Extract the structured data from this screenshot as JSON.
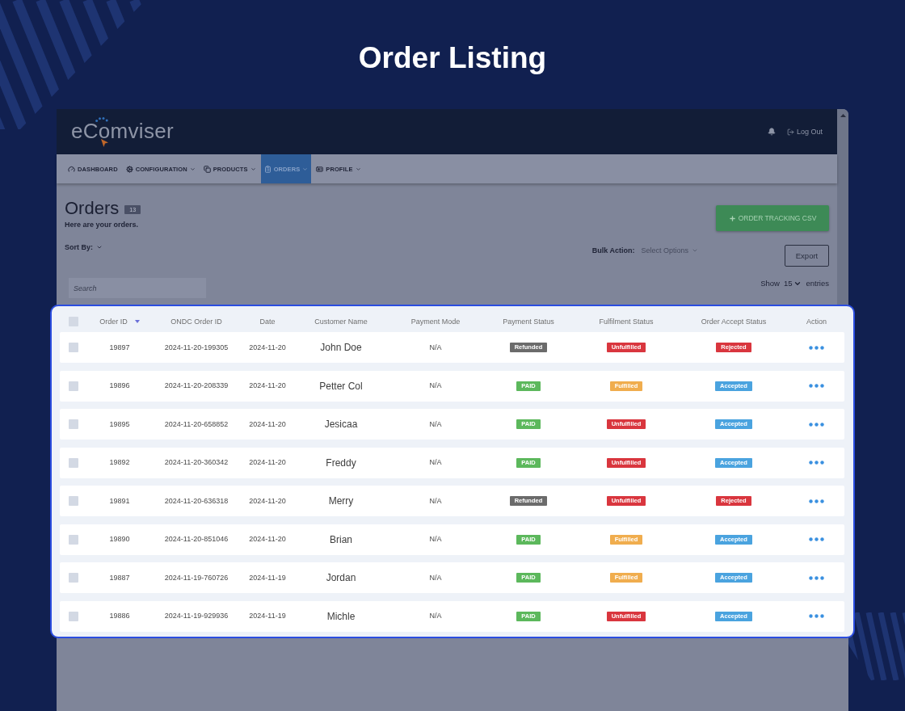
{
  "page": {
    "title": "Order Listing"
  },
  "app": {
    "logo": "eComviser",
    "logout": "Log Out",
    "nav": [
      {
        "label": "DASHBOARD",
        "dropdown": false,
        "selected": false
      },
      {
        "label": "CONFIGURATION",
        "dropdown": true,
        "selected": false
      },
      {
        "label": "PRODUCTS",
        "dropdown": true,
        "selected": false
      },
      {
        "label": "ORDERS",
        "dropdown": true,
        "selected": true
      },
      {
        "label": "PROFILE",
        "dropdown": true,
        "selected": false
      }
    ]
  },
  "orders": {
    "title": "Orders",
    "count": "13",
    "subtitle": "Here are your orders.",
    "sort_by": "Sort By:",
    "csv_button": "ORDER TRACKING CSV",
    "bulk_action": {
      "label": "Bulk Action:",
      "placeholder": "Select Options"
    },
    "export_button": "Export",
    "search": {
      "placeholder": "Search"
    },
    "show_entries": {
      "label": "Show",
      "value": "15",
      "suffix": "entries"
    }
  },
  "table": {
    "select_all": {
      "checked": false
    },
    "columns": [
      {
        "label": "Order ID",
        "sorted": true
      },
      {
        "label": "ONDC Order ID",
        "sorted": false
      },
      {
        "label": "Date",
        "sorted": false
      },
      {
        "label": "Customer Name",
        "sorted": false
      },
      {
        "label": "Payment Mode",
        "sorted": false
      },
      {
        "label": "Payment Status",
        "sorted": false
      },
      {
        "label": "Fulfilment Status",
        "sorted": false
      },
      {
        "label": "Order Accept Status",
        "sorted": false
      },
      {
        "label": "Action",
        "sorted": false
      }
    ],
    "rows": [
      {
        "checked": false,
        "order_id": "19897",
        "ondc_order_id": "2024-11-20-199305",
        "date": "2024-11-20",
        "customer_name": "John Doe",
        "payment_mode": "N/A",
        "payment_status": {
          "label": "Refunded",
          "color": "#6b6b6b"
        },
        "fulfilment_status": {
          "label": "Unfulfilled",
          "color": "#d9363e"
        },
        "accept_status": {
          "label": "Rejected",
          "color": "#d9363e"
        }
      },
      {
        "checked": false,
        "order_id": "19896",
        "ondc_order_id": "2024-11-20-208339",
        "date": "2024-11-20",
        "customer_name": "Petter Col",
        "payment_mode": "N/A",
        "payment_status": {
          "label": "PAID",
          "color": "#5cb85c"
        },
        "fulfilment_status": {
          "label": "Fulfilled",
          "color": "#f0ad4e"
        },
        "accept_status": {
          "label": "Accepted",
          "color": "#4aa3df"
        }
      },
      {
        "checked": false,
        "order_id": "19895",
        "ondc_order_id": "2024-11-20-658852",
        "date": "2024-11-20",
        "customer_name": "Jesicaa",
        "payment_mode": "N/A",
        "payment_status": {
          "label": "PAID",
          "color": "#5cb85c"
        },
        "fulfilment_status": {
          "label": "Unfulfilled",
          "color": "#d9363e"
        },
        "accept_status": {
          "label": "Accepted",
          "color": "#4aa3df"
        }
      },
      {
        "checked": false,
        "order_id": "19892",
        "ondc_order_id": "2024-11-20-360342",
        "date": "2024-11-20",
        "customer_name": "Freddy",
        "payment_mode": "N/A",
        "payment_status": {
          "label": "PAID",
          "color": "#5cb85c"
        },
        "fulfilment_status": {
          "label": "Unfulfilled",
          "color": "#d9363e"
        },
        "accept_status": {
          "label": "Accepted",
          "color": "#4aa3df"
        }
      },
      {
        "checked": false,
        "order_id": "19891",
        "ondc_order_id": "2024-11-20-636318",
        "date": "2024-11-20",
        "customer_name": "Merry",
        "payment_mode": "N/A",
        "payment_status": {
          "label": "Refunded",
          "color": "#6b6b6b"
        },
        "fulfilment_status": {
          "label": "Unfulfilled",
          "color": "#d9363e"
        },
        "accept_status": {
          "label": "Rejected",
          "color": "#d9363e"
        }
      },
      {
        "checked": false,
        "order_id": "19890",
        "ondc_order_id": "2024-11-20-851046",
        "date": "2024-11-20",
        "customer_name": "Brian",
        "payment_mode": "N/A",
        "payment_status": {
          "label": "PAID",
          "color": "#5cb85c"
        },
        "fulfilment_status": {
          "label": "Fulfilled",
          "color": "#f0ad4e"
        },
        "accept_status": {
          "label": "Accepted",
          "color": "#4aa3df"
        }
      },
      {
        "checked": false,
        "order_id": "19887",
        "ondc_order_id": "2024-11-19-760726",
        "date": "2024-11-19",
        "customer_name": "Jordan",
        "payment_mode": "N/A",
        "payment_status": {
          "label": "PAID",
          "color": "#5cb85c"
        },
        "fulfilment_status": {
          "label": "Fulfilled",
          "color": "#f0ad4e"
        },
        "accept_status": {
          "label": "Accepted",
          "color": "#4aa3df"
        }
      },
      {
        "checked": false,
        "order_id": "19886",
        "ondc_order_id": "2024-11-19-929936",
        "date": "2024-11-19",
        "customer_name": "Michle",
        "payment_mode": "N/A",
        "payment_status": {
          "label": "PAID",
          "color": "#5cb85c"
        },
        "fulfilment_status": {
          "label": "Unfulfilled",
          "color": "#d9363e"
        },
        "accept_status": {
          "label": "Accepted",
          "color": "#4aa3df"
        }
      }
    ]
  }
}
